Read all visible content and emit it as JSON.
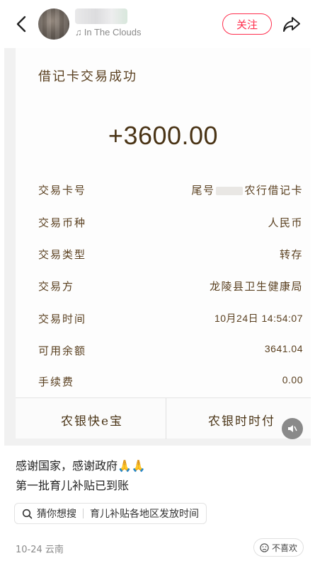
{
  "header": {
    "username": "",
    "music_label": "In The Clouds",
    "follow_label": "关注"
  },
  "receipt": {
    "title": "借记卡交易成功",
    "amount": "+3600.00",
    "rows": [
      {
        "key": "交易卡号",
        "value_prefix": "尾号",
        "value_suffix": "农行借记卡"
      },
      {
        "key": "交易币种",
        "value": "人民币"
      },
      {
        "key": "交易类型",
        "value": "转存"
      },
      {
        "key": "交易方",
        "value": "龙陵县卫生健康局"
      },
      {
        "key": "交易时间",
        "value": "10月24日 14:54:07"
      },
      {
        "key": "可用余额",
        "value": "3641.04"
      },
      {
        "key": "手续费",
        "value": "0.00"
      }
    ],
    "buttons": {
      "left": "农银快e宝",
      "right": "农银时时付"
    }
  },
  "caption": {
    "line1": "感谢国家，感谢政府🙏🙏",
    "line2": "第一批育儿补贴已到账"
  },
  "search_pill": {
    "prefix": "猜你想搜",
    "query": "育儿补贴各地区发放时间"
  },
  "meta": {
    "date_location": "10-24 云南",
    "dislike_label": "不喜欢"
  },
  "colors": {
    "accent": "#ff2e4d",
    "receipt_text": "#5a4020"
  }
}
